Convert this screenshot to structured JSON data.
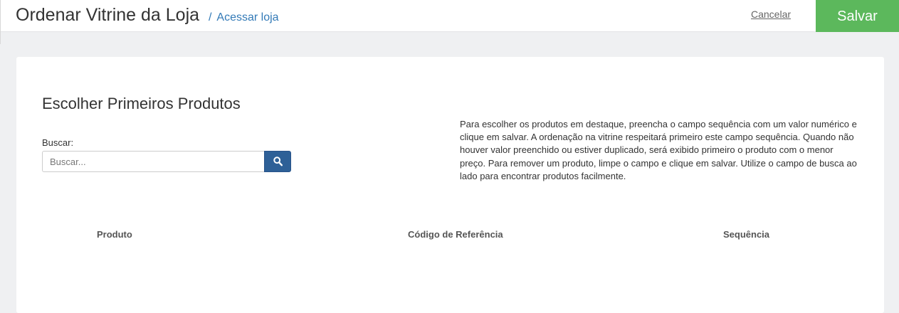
{
  "header": {
    "title": "Ordenar Vitrine da Loja",
    "breadcrumb_separator": "/",
    "breadcrumb_link": "Acessar loja",
    "cancel_label": "Cancelar",
    "save_label": "Salvar"
  },
  "section": {
    "title": "Escolher Primeiros Produtos",
    "search_label": "Buscar:",
    "search_placeholder": "Buscar...",
    "search_value": "",
    "search_icon": "search-icon",
    "help_text": "Para escolher os produtos em destaque, preencha o campo sequência com um valor numérico e clique em salvar. A ordenação na vitrine respeitará primeiro este campo sequência. Quando não houver valor preenchido ou estiver duplicado, será exibido primeiro o produto com o menor preço. Para remover um produto, limpe o campo e clique em salvar. Utilize o campo de busca ao lado para encontrar produtos facilmente."
  },
  "table": {
    "columns": [
      "Produto",
      "Código de Referência",
      "Sequência"
    ],
    "rows": []
  },
  "colors": {
    "save_button": "#5cb85c",
    "search_button": "#2e6097",
    "link": "#337ab7",
    "background": "#eff0f2"
  }
}
